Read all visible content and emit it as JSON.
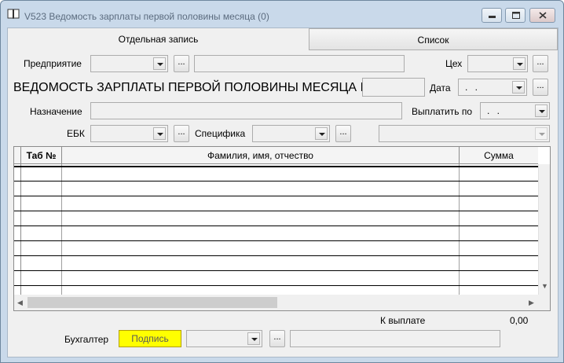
{
  "window": {
    "title": "V523 Ведомость зарплаты первой половины месяца (0)"
  },
  "tabs": [
    {
      "label": "Отдельная запись",
      "active": true
    },
    {
      "label": "Список",
      "active": false
    }
  ],
  "form": {
    "enterprise_label": "Предприятие",
    "workshop_label": "Цех",
    "doc_title": "ВЕДОМОСТЬ ЗАРПЛАТЫ ПЕРВОЙ ПОЛОВИНЫ МЕСЯЦА №",
    "date_label": "Дата",
    "date_value": ". .",
    "purpose_label": "Назначение",
    "pay_by_label": "Выплатить по",
    "pay_by_value": ". .",
    "ebk_label": "ЕБК",
    "specifics_label": "Специфика",
    "dots_label": "..."
  },
  "table": {
    "columns": [
      "Таб №",
      "Фамилия, имя, отчество",
      "Сумма"
    ]
  },
  "footer": {
    "total_label": "К выплате",
    "total_value": "0,00",
    "accountant_label": "Бухгалтер",
    "sign_button": "Подпись"
  },
  "colors": {
    "sign_button": "#ffff00",
    "window_frame": "#c9d9ea"
  }
}
